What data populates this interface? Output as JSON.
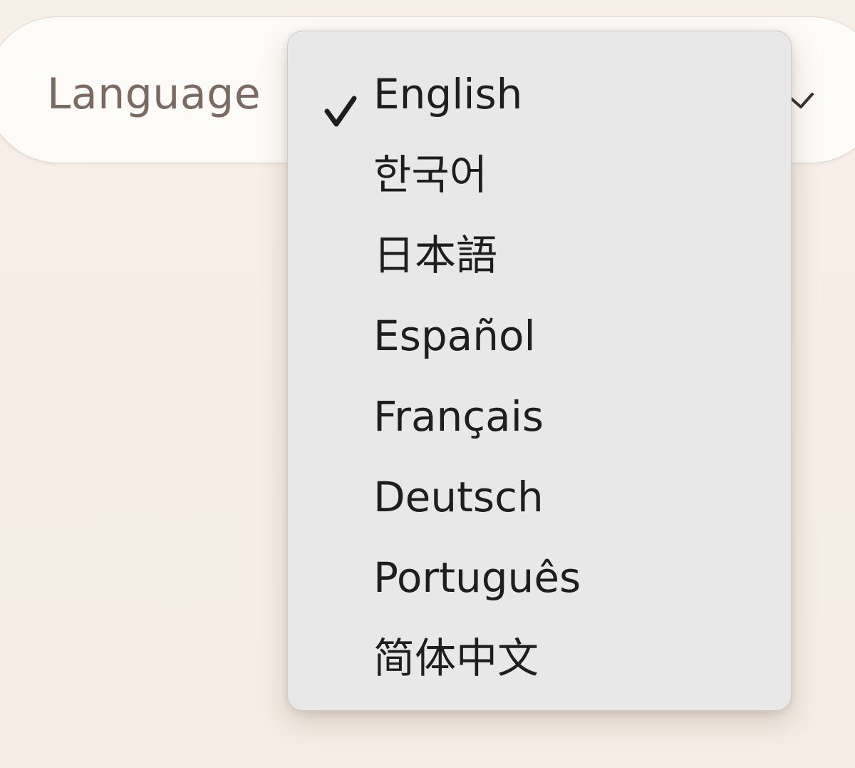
{
  "setting": {
    "label": "Language",
    "chevron_icon": "chevron-down-icon"
  },
  "dropdown": {
    "selected": "English",
    "check_icon": "checkmark-icon",
    "options": [
      {
        "label": "English",
        "selected": true
      },
      {
        "label": "한국어",
        "selected": false
      },
      {
        "label": "日本語",
        "selected": false
      },
      {
        "label": "Español",
        "selected": false
      },
      {
        "label": "Français",
        "selected": false
      },
      {
        "label": "Deutsch",
        "selected": false
      },
      {
        "label": "Português",
        "selected": false
      },
      {
        "label": "简体中文",
        "selected": false
      }
    ]
  },
  "colors": {
    "background": "#f5eee6",
    "row_background": "#fdfbf8",
    "label_text": "#7a6a62",
    "menu_background": "#e9e8e8",
    "menu_text": "#1e1e1e"
  }
}
